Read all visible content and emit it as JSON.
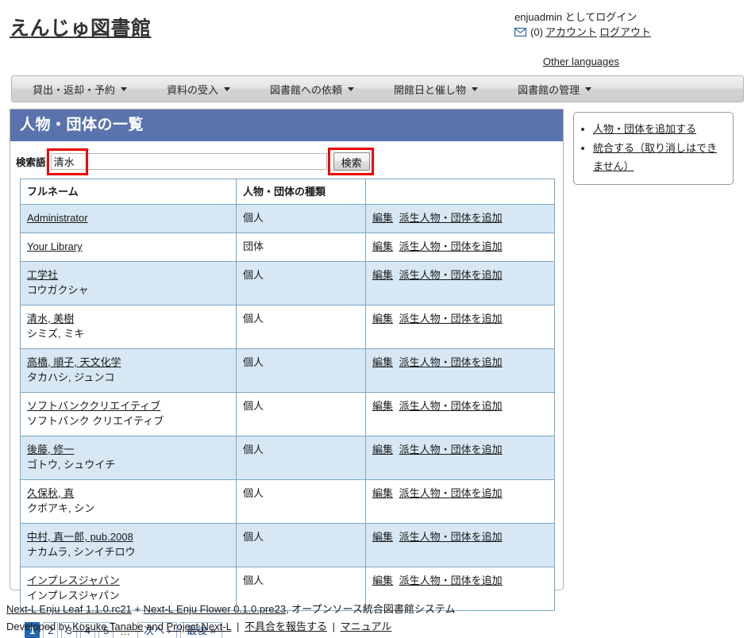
{
  "header": {
    "site_title": "えんじゅ図書館",
    "logged_in_as": "enjuadmin としてログイン",
    "mail_icon": "mail-icon",
    "message_count": "(0)",
    "account_link": "アカウント",
    "logout_link": "ログアウト",
    "other_languages": "Other languages"
  },
  "nav": {
    "items": [
      {
        "label": "貸出・返却・予約"
      },
      {
        "label": "資料の受入"
      },
      {
        "label": "図書館への依頼"
      },
      {
        "label": "開館日と催し物"
      },
      {
        "label": "図書館の管理"
      }
    ]
  },
  "panel": {
    "title": "人物・団体の一覧",
    "search_label": "検索語:",
    "search_value": "清水",
    "search_placeholder": "",
    "search_button": "検索"
  },
  "table": {
    "headers": [
      "フルネーム",
      "人物・団体の種類",
      ""
    ],
    "rows": [
      {
        "name": "Administrator",
        "kana": "",
        "type": "個人",
        "edit": "編集",
        "add": "派生人物・団体を追加"
      },
      {
        "name": "Your Library",
        "kana": "",
        "type": "団体",
        "edit": "編集",
        "add": "派生人物・団体を追加"
      },
      {
        "name": "工学社",
        "kana": "コウガクシャ",
        "type": "個人",
        "edit": "編集",
        "add": "派生人物・団体を追加"
      },
      {
        "name": "清水, 美樹",
        "kana": "シミズ, ミキ",
        "type": "個人",
        "edit": "編集",
        "add": "派生人物・団体を追加"
      },
      {
        "name": "高橋, 順子, 天文化学",
        "kana": "タカハシ, ジュンコ",
        "type": "個人",
        "edit": "編集",
        "add": "派生人物・団体を追加"
      },
      {
        "name": "ソフトバンククリエイティブ",
        "kana": "ソフトバンク クリエイティブ",
        "type": "個人",
        "edit": "編集",
        "add": "派生人物・団体を追加"
      },
      {
        "name": "後藤, 修一",
        "kana": "ゴトウ, シュウイチ",
        "type": "個人",
        "edit": "編集",
        "add": "派生人物・団体を追加"
      },
      {
        "name": "久保秋, 真",
        "kana": "クボアキ, シン",
        "type": "個人",
        "edit": "編集",
        "add": "派生人物・団体を追加"
      },
      {
        "name": "中村, 真一郎, pub.2008",
        "kana": "ナカムラ, シンイチロウ",
        "type": "個人",
        "edit": "編集",
        "add": "派生人物・団体を追加"
      },
      {
        "name": "インプレスジャパン",
        "kana": "インプレスジャパン",
        "type": "個人",
        "edit": "編集",
        "add": "派生人物・団体を追加"
      }
    ]
  },
  "pagination": {
    "current": "1",
    "pages": [
      "1",
      "2",
      "3",
      "4",
      "5"
    ],
    "gap": "…",
    "next": "次へ ›",
    "last": "最後 »"
  },
  "sidebar": {
    "items": [
      {
        "label": "人物・団体を追加する"
      },
      {
        "label": "統合する（取り消しはできません）"
      }
    ]
  },
  "footer": {
    "leaf": "Next-L Enju Leaf 1.1.0.rc21",
    "plus": "+",
    "flower": "Next-L Enju Flower 0.1.0.pre23",
    "tagline": ", オープンソース統合図書館システム",
    "developed_by": "Developed by",
    "author": "Kosuke Tanabe",
    "and": "and",
    "project": "Project Next-L",
    "sep1": "|",
    "bug_report": "不具合を報告する",
    "sep2": "|",
    "manual": "マニュアル"
  },
  "colors": {
    "panel_title_bg": "#5a73ad",
    "row_odd_bg": "#d7e8f4",
    "table_border": "#7ba7c6",
    "pagination_current_bg": "#2267b0",
    "highlight": "#ee0000"
  }
}
